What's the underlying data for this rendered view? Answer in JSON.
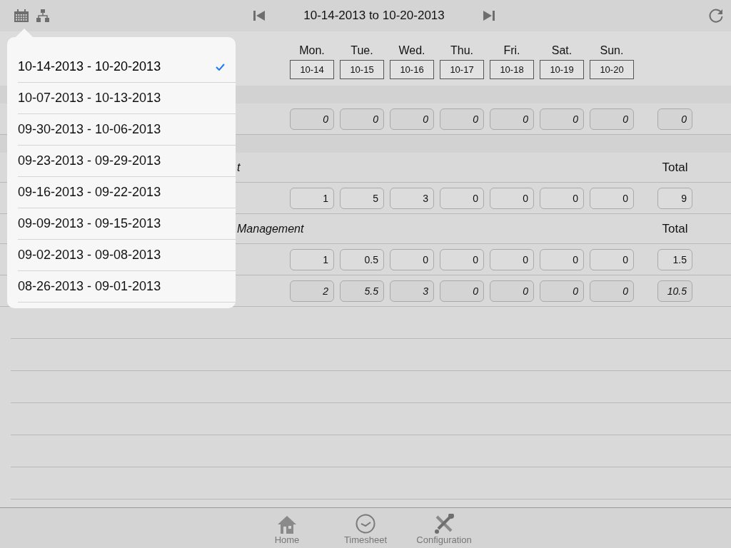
{
  "toolbar": {
    "range_title": "10-14-2013 to 10-20-2013"
  },
  "days": [
    {
      "name": "Mon.",
      "date": "10-14"
    },
    {
      "name": "Tue.",
      "date": "10-15"
    },
    {
      "name": "Wed.",
      "date": "10-16"
    },
    {
      "name": "Thu.",
      "date": "10-17"
    },
    {
      "name": "Fri.",
      "date": "10-18"
    },
    {
      "name": "Sat.",
      "date": "10-19"
    },
    {
      "name": "Sun.",
      "date": "10-20"
    }
  ],
  "rows": [
    {
      "kind": "summary",
      "cells": [
        "0",
        "0",
        "0",
        "0",
        "0",
        "0",
        "0"
      ],
      "total": "0"
    },
    {
      "kind": "spacer"
    },
    {
      "kind": "header",
      "label": "t",
      "total_label": "Total"
    },
    {
      "kind": "entry",
      "cells": [
        "1",
        "5",
        "3",
        "0",
        "0",
        "0",
        "0"
      ],
      "total": "9"
    },
    {
      "kind": "header",
      "label": "Management",
      "total_label": "Total"
    },
    {
      "kind": "entry",
      "cells": [
        "1",
        "0.5",
        "0",
        "0",
        "0",
        "0",
        "0"
      ],
      "total": "1.5"
    },
    {
      "kind": "summary",
      "cells": [
        "2",
        "5.5",
        "3",
        "0",
        "0",
        "0",
        "0"
      ],
      "total": "10.5"
    }
  ],
  "popover": {
    "items": [
      {
        "label": "10-14-2013 - 10-20-2013",
        "selected": true
      },
      {
        "label": "10-07-2013 - 10-13-2013",
        "selected": false
      },
      {
        "label": "09-30-2013 - 10-06-2013",
        "selected": false
      },
      {
        "label": "09-23-2013 - 09-29-2013",
        "selected": false
      },
      {
        "label": "09-16-2013 - 09-22-2013",
        "selected": false
      },
      {
        "label": "09-09-2013 - 09-15-2013",
        "selected": false
      },
      {
        "label": "09-02-2013 - 09-08-2013",
        "selected": false
      },
      {
        "label": "08-26-2013 - 09-01-2013",
        "selected": false
      }
    ]
  },
  "tabs": [
    {
      "kind": "home",
      "label": "Home"
    },
    {
      "kind": "clock",
      "label": "Timesheet"
    },
    {
      "kind": "tools",
      "label": "Configuration"
    }
  ]
}
